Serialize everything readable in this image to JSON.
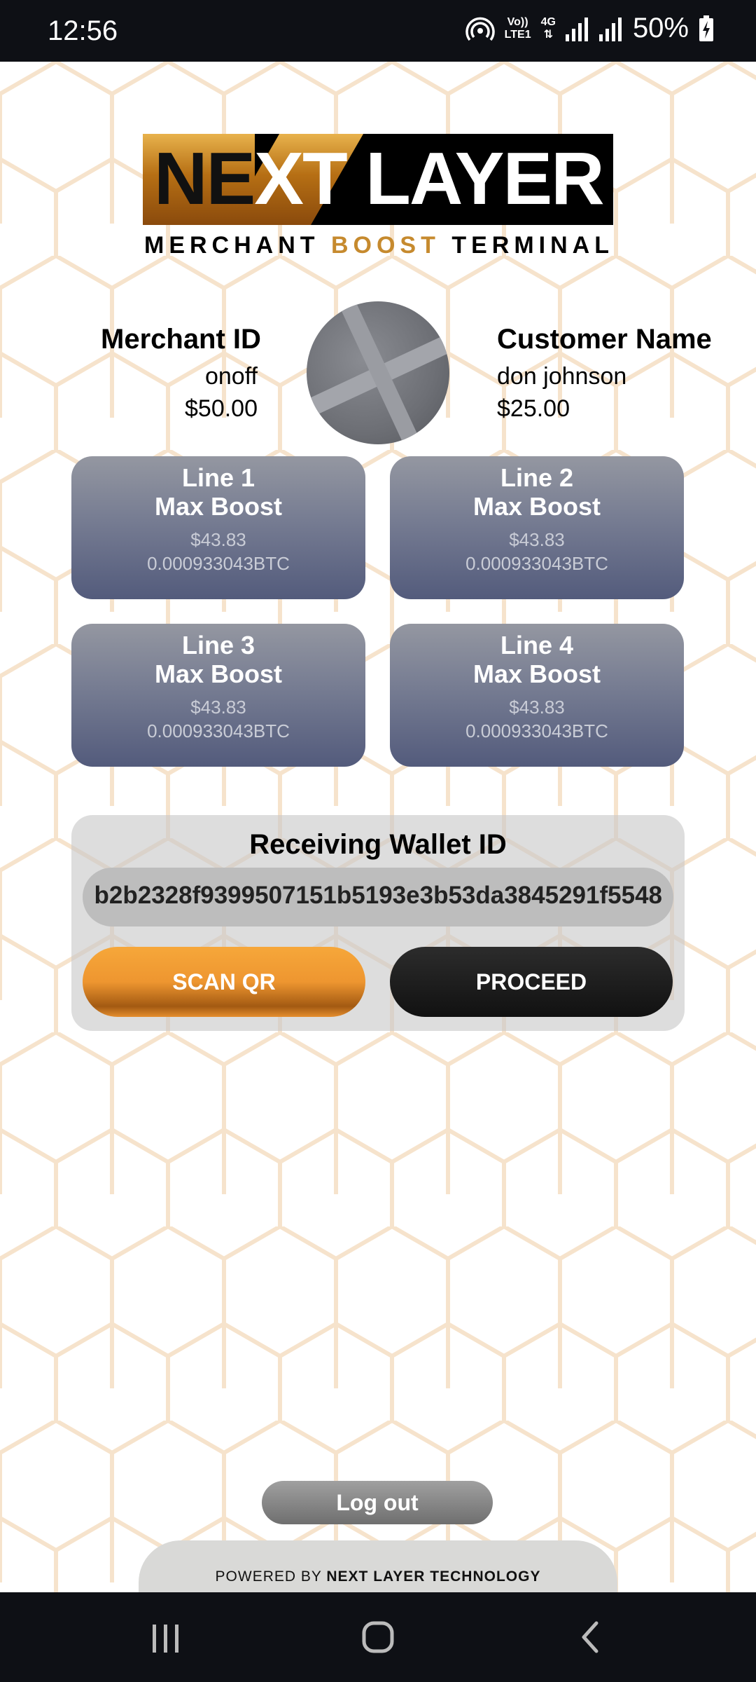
{
  "status_bar": {
    "time": "12:56",
    "volte": "Vo))",
    "lte": "LTE1",
    "network": "4G",
    "battery": "50%"
  },
  "logo": {
    "word_left": "NE",
    "word_x": "X",
    "word_right": "T LAYER",
    "sub_left": "MERCHANT ",
    "sub_mid": "BOOST",
    "sub_right": " TERMINAL"
  },
  "merchant": {
    "label": "Merchant ID",
    "name": "onoff",
    "amount": "$50.00"
  },
  "customer": {
    "label": "Customer Name",
    "name": "don johnson",
    "amount": "$25.00"
  },
  "lines": [
    {
      "title": "Line 1",
      "subtitle": "Max Boost",
      "usd": "$43.83",
      "btc": "0.000933043BTC"
    },
    {
      "title": "Line 2",
      "subtitle": "Max Boost",
      "usd": "$43.83",
      "btc": "0.000933043BTC"
    },
    {
      "title": "Line 3",
      "subtitle": "Max Boost",
      "usd": "$43.83",
      "btc": "0.000933043BTC"
    },
    {
      "title": "Line 4",
      "subtitle": "Max Boost",
      "usd": "$43.83",
      "btc": "0.000933043BTC"
    }
  ],
  "wallet": {
    "title": "Receiving Wallet ID",
    "value": "b2b2328f9399507151b5193e3b53da3845291f5548",
    "scan_label": "SCAN QR",
    "proceed_label": "PROCEED"
  },
  "logout_label": "Log out",
  "footer": {
    "prefix": "POWERED BY ",
    "brand": "NEXT LAYER TECHNOLOGY"
  },
  "colors": {
    "accent_gold": "#ee9630",
    "card_blue": "#535b7c",
    "hex_line": "#f6e3cc"
  },
  "icons": [
    "hotspot-icon",
    "signal-icon",
    "battery-charging-icon",
    "recents-icon",
    "home-icon",
    "back-icon"
  ]
}
